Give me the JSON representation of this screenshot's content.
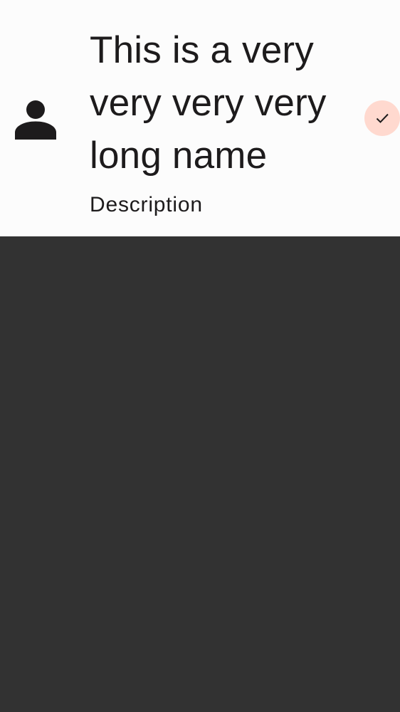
{
  "list_item": {
    "title": "This is a very very very very long name",
    "description": "Description",
    "leading_icon": "person-icon",
    "trailing_icon": "check-icon"
  },
  "colors": {
    "item_background": "#fcfcfc",
    "screen_background": "#323232",
    "text": "#1d1b1c",
    "check_button_background": "#ffd9cf"
  }
}
